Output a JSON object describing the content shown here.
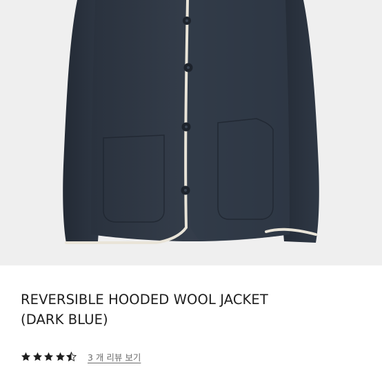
{
  "product": {
    "image_alt": "Reversible hooded wool jacket, dark blue, with white piping",
    "colors": {
      "jacket": "#2e3744",
      "piping": "#e9e4d8",
      "background": "#efefef"
    },
    "title_line1": "REVERSIBLE HOODED WOOL JACKET",
    "title_line2": "(DARK BLUE)"
  },
  "rating": {
    "value": 4.5,
    "max": 5,
    "icon": "star-icon",
    "review_link": "3 개 리뷰 보기"
  }
}
